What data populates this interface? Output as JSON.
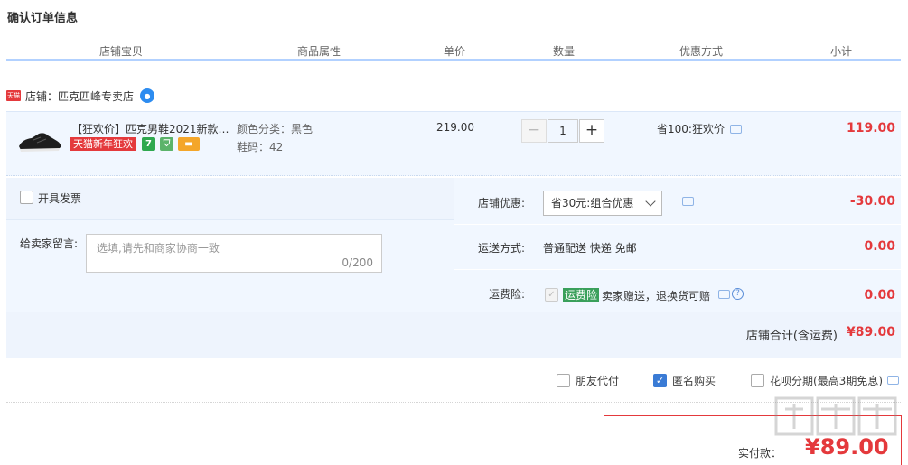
{
  "page": {
    "title": "确认订单信息"
  },
  "columns": [
    "店铺宝贝",
    "商品属性",
    "单价",
    "数量",
    "优惠方式",
    "小计"
  ],
  "shop": {
    "badge": "天猫",
    "label": "店铺：匹克匹峰专卖店"
  },
  "item": {
    "title": "【狂欢价】匹克男鞋2021新款…",
    "promo_tag": "天猫新年狂欢",
    "icon_7": "7",
    "attr_color": "颜色分类：黑色",
    "attr_size": "鞋码：42",
    "price": "219.00",
    "quantity": "1",
    "minus": "−",
    "plus": "+",
    "discount": "省100:狂欢价",
    "subtotal": "119.00"
  },
  "invoice": {
    "label": "开具发票"
  },
  "memo": {
    "label": "给卖家留言:",
    "placeholder": "选填,请先和商家协商一致",
    "counter": "0/200"
  },
  "shop_discount": {
    "label": "店铺优惠:",
    "selected": "省30元:组合优惠",
    "amount": "-30.00"
  },
  "shipping": {
    "label": "运送方式:",
    "value": "普通配送 快递 免邮",
    "amount": "0.00"
  },
  "insurance": {
    "label": "运费险:",
    "tag": "运费险",
    "text": "卖家赠送，退换货可赔",
    "amount": "0.00"
  },
  "shop_total": {
    "label": "店铺合计(含运费)",
    "amount": "¥89.00"
  },
  "options": {
    "friend_pay": "朋友代付",
    "anonymous": "匿名购买",
    "huabei": "花呗分期(最高3期免息)"
  },
  "payment": {
    "label": "实付款：",
    "amount": "¥89.00"
  },
  "colors": {
    "accent_red": "#e4393c",
    "header_line": "#b2d1ff",
    "panel_bg": "#eef4fd"
  }
}
